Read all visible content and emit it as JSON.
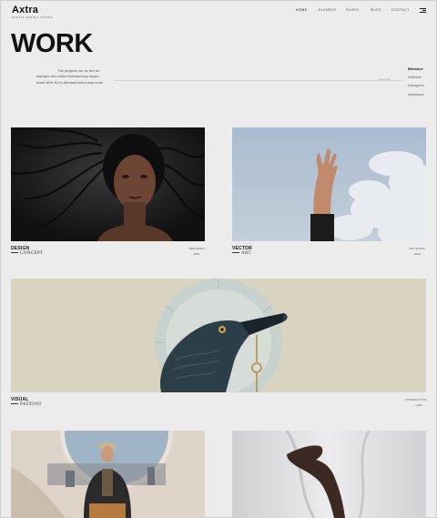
{
  "header": {
    "logo": "Axtra",
    "logo_sub": "DIGITAL AGENCY STUDIO",
    "nav": [
      "HOME",
      "ELEMENT",
      "PAGES",
      "BLOG",
      "CONTACT"
    ]
  },
  "hero": {
    "title": "WORK",
    "intro": "The projects we do are for startups who make bureaucracy easier, teach tech for in-demand and many more",
    "rule_label": "Know more",
    "social": [
      "Behance",
      "Dribbble",
      "Instagram",
      "Awwward"
    ]
  },
  "projects": [
    {
      "title": "DESIGN",
      "subtitle": "CONCEPT",
      "category": "BRANDING",
      "year": "- 2019"
    },
    {
      "title": "VECTOR",
      "subtitle": "ART",
      "category": "ART/WORK",
      "year": "- 2019"
    },
    {
      "title": "VISUAL",
      "subtitle": "PASTONI",
      "category": "INTERACTION",
      "year": "- 2019"
    },
    {
      "title": "",
      "subtitle": "",
      "category": "",
      "year": ""
    },
    {
      "title": "",
      "subtitle": "",
      "category": "",
      "year": ""
    }
  ],
  "colors": {
    "background": "#ececec",
    "text": "#111111",
    "accent_panel": "#d8d3bf",
    "sky": "#b8c7d6"
  }
}
